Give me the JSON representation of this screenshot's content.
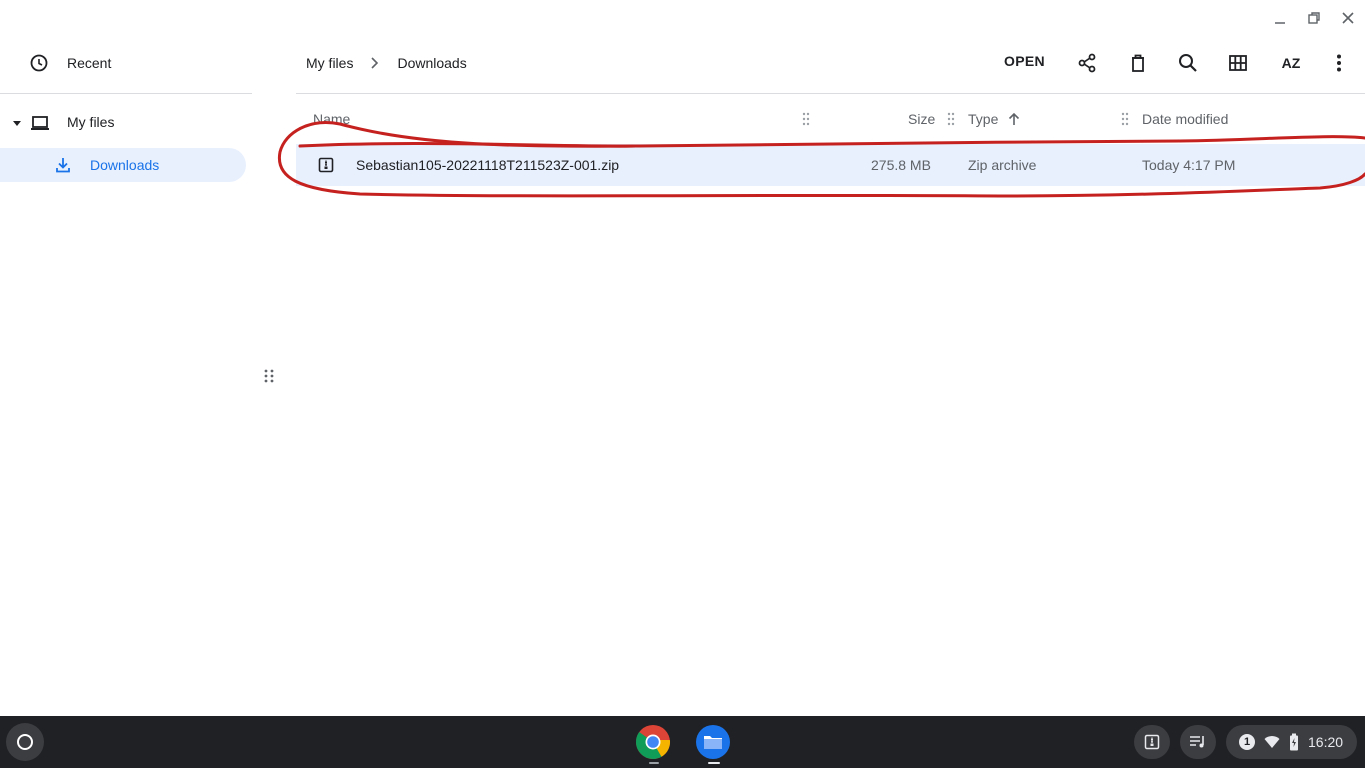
{
  "sidebar": {
    "recent_label": "Recent",
    "my_files_label": "My files",
    "downloads_label": "Downloads"
  },
  "breadcrumb": {
    "root": "My files",
    "current": "Downloads"
  },
  "toolbar": {
    "open_label": "OPEN",
    "sort_label": "AZ"
  },
  "table": {
    "columns": [
      "Name",
      "Size",
      "Type",
      "Date modified"
    ],
    "sort_column": "Type",
    "sort_direction": "ascending",
    "rows": [
      {
        "name": "Sebastian105-20221118T211523Z-001.zip",
        "size": "275.8 MB",
        "type": "Zip archive",
        "date": "Today 4:17 PM",
        "selected": true
      }
    ]
  },
  "annotation": {
    "color": "#c5221f",
    "shape": "hand-drawn ellipse around selected row"
  },
  "shelf": {
    "apps": [
      "chrome-icon",
      "files-app-icon"
    ],
    "notification_count": "1",
    "time": "16:20"
  },
  "colors": {
    "accent": "#1a73e8",
    "selection": "#e8f0fe",
    "shelf_bg": "#202124"
  }
}
